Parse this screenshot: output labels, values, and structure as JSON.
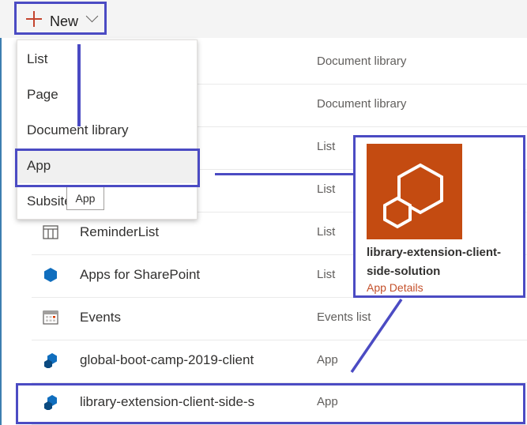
{
  "command_bar": {
    "new_label": "New"
  },
  "new_menu": {
    "items": [
      {
        "label": "List"
      },
      {
        "label": "Page"
      },
      {
        "label": "Document library"
      },
      {
        "label": "App"
      },
      {
        "label": "Subsite"
      }
    ],
    "tooltip": "App"
  },
  "rows": [
    {
      "name": "",
      "type": "Document library",
      "icon": "none"
    },
    {
      "name": "",
      "type": "Document library",
      "icon": "none"
    },
    {
      "name": "",
      "type": "List",
      "icon": "none"
    },
    {
      "name": "",
      "type": "List",
      "icon": "none"
    },
    {
      "name": "ReminderList",
      "type": "List",
      "icon": "list-icon"
    },
    {
      "name": "Apps for SharePoint",
      "type": "List",
      "icon": "hexagon-icon"
    },
    {
      "name": "Events",
      "type": "Events list",
      "icon": "calendar-icon"
    },
    {
      "name": "global-boot-camp-2019-client",
      "type": "App",
      "icon": "app-package-icon"
    },
    {
      "name": "library-extension-client-side-s",
      "type": "App",
      "icon": "app-package-icon"
    }
  ],
  "app_card": {
    "title": "library-extension-client-side-solution",
    "link": "App Details",
    "tile_color": "#c44b11"
  },
  "colors": {
    "highlight": "#4b4bc3",
    "accent": "#c4442e"
  }
}
